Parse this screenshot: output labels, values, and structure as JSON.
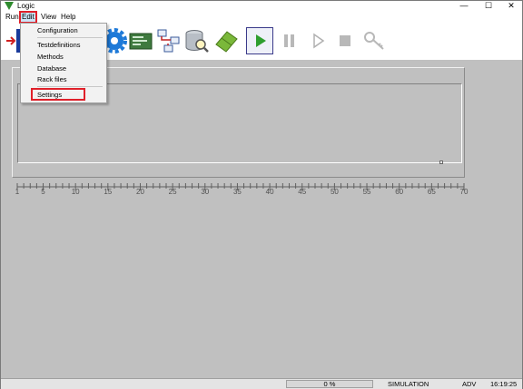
{
  "window": {
    "title": "Logic",
    "minimize": "—",
    "maximize": "☐",
    "close": "✕"
  },
  "menubar": {
    "items": [
      "Run",
      "Edit",
      "View",
      "Help"
    ]
  },
  "edit_menu": {
    "items": [
      "Configuration",
      "Testdefinitions",
      "Methods",
      "Database",
      "Rack files",
      "Settings"
    ]
  },
  "toolbar": {
    "icons": [
      "arrow-icon",
      "gear-icon",
      "board-icon",
      "network-icon",
      "database-search-icon",
      "eraser-icon",
      "play-icon",
      "pause-icon",
      "step-icon",
      "stop-icon",
      "key-icon"
    ]
  },
  "ruler": {
    "ticks": [
      "1",
      "5",
      "10",
      "15",
      "20",
      "25",
      "30",
      "35",
      "40",
      "45",
      "50",
      "55",
      "60",
      "65",
      "70"
    ]
  },
  "status": {
    "progress": "0 %",
    "progress_value": 0,
    "mode": "SIMULATION",
    "level": "ADV",
    "time": "16:19:25"
  },
  "colors": {
    "highlight": "#e0202a",
    "play": "#2e9e2e"
  }
}
